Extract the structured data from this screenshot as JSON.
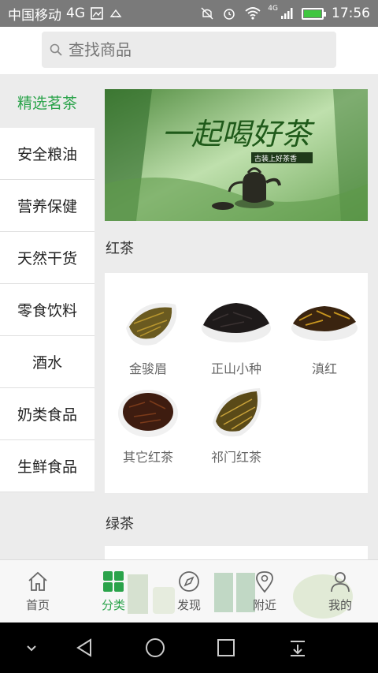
{
  "status_bar": {
    "carrier": "中国移动",
    "network": "4G",
    "signal_label": "4G",
    "time": "17:56"
  },
  "search": {
    "placeholder": "查找商品"
  },
  "sidebar": {
    "items": [
      {
        "label": "精选茗茶",
        "active": true
      },
      {
        "label": "安全粮油"
      },
      {
        "label": "营养保健"
      },
      {
        "label": "天然干货"
      },
      {
        "label": "零食饮料"
      },
      {
        "label": "酒水"
      },
      {
        "label": "奶类食品"
      },
      {
        "label": "生鲜食品"
      }
    ]
  },
  "banner": {
    "headline": "一起喝好茶",
    "sub": "古装上好茶香"
  },
  "sections": [
    {
      "title": "红茶",
      "products": [
        "金骏眉",
        "正山小种",
        "滇红",
        "其它红茶",
        "祁门红茶"
      ]
    },
    {
      "title": "绿茶",
      "products": []
    }
  ],
  "bottom_nav": [
    {
      "label": "首页",
      "icon": "home-icon"
    },
    {
      "label": "分类",
      "icon": "category-icon",
      "active": true
    },
    {
      "label": "发现",
      "icon": "compass-icon"
    },
    {
      "label": "附近",
      "icon": "location-pin-icon"
    },
    {
      "label": "我的",
      "icon": "person-icon"
    }
  ],
  "colors": {
    "accent": "#2aa34a",
    "status_bar": "#7a7a7a",
    "background": "#ececec"
  }
}
